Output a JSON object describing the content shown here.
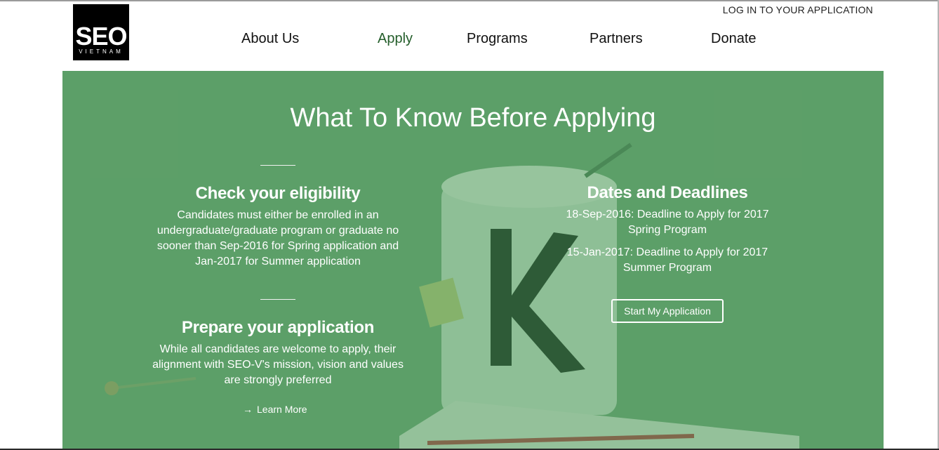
{
  "header": {
    "logo": {
      "main": "SEO",
      "sub": "VIETNAM"
    },
    "login_link": "LOG IN TO YOUR APPLICATION",
    "nav": [
      {
        "label": "About Us"
      },
      {
        "label": "Apply",
        "active": true
      },
      {
        "label": "Programs"
      },
      {
        "label": "Partners"
      },
      {
        "label": "Donate"
      }
    ]
  },
  "hero": {
    "title": "What To Know Before Applying",
    "eligibility": {
      "heading": "Check your eligibility",
      "text": "Candidates must either be enrolled in an undergraduate/graduate program or graduate no sooner than Sep-2016 for Spring application and Jan-2017 for Summer application"
    },
    "prepare": {
      "heading": "Prepare your application",
      "text": "While all candidates are welcome to apply, their alignment with SEO-V's mission, vision and values are strongly preferred",
      "learn_more": "Learn More",
      "learn_more_icon": "arrow-right-icon"
    },
    "deadlines": {
      "heading": "Dates and Deadlines",
      "items": [
        "18-Sep-2016: Deadline to Apply for 2017 Spring Program",
        "15-Jan-2017: Deadline to Apply for 2017 Summer Program"
      ],
      "cta": "Start My Application"
    }
  },
  "colors": {
    "accent_green": "#245e2b",
    "hero_overlay": "#5f9a69"
  }
}
